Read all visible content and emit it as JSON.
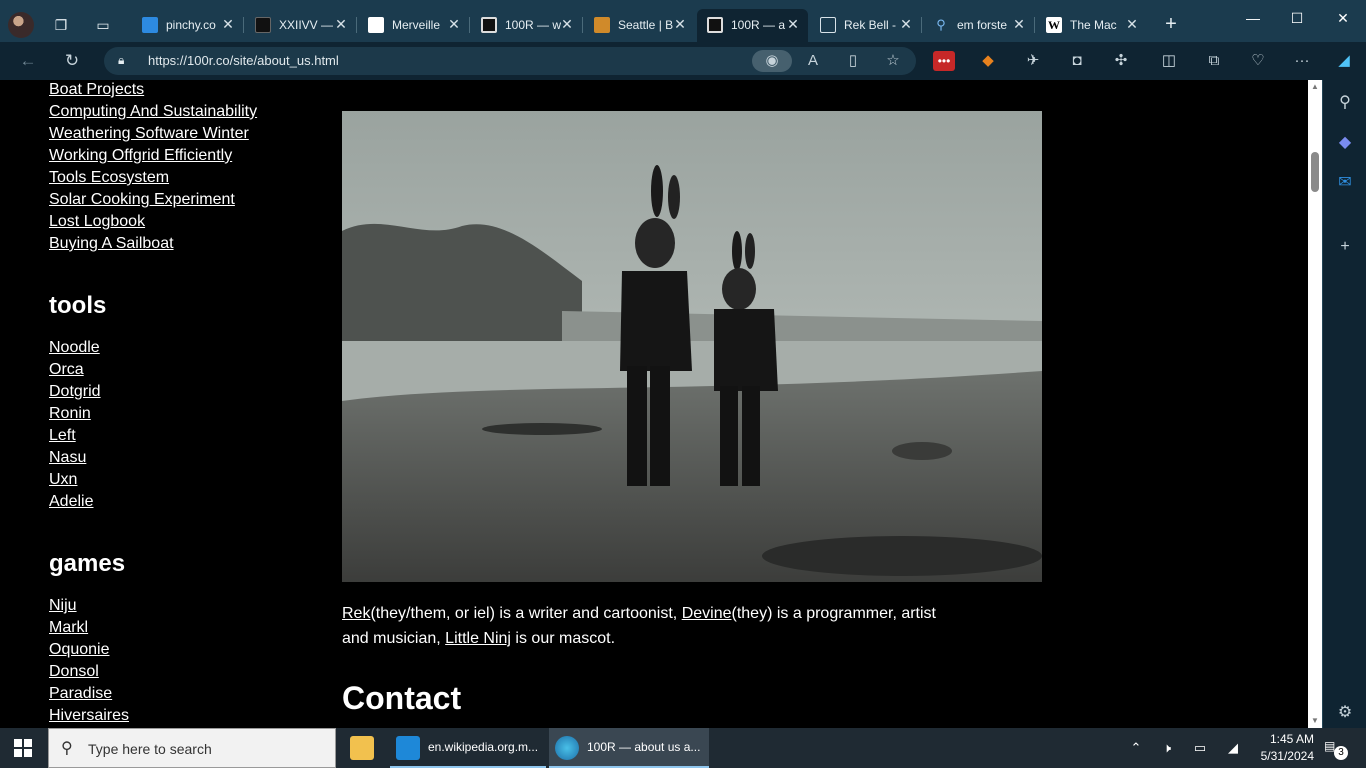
{
  "browser": {
    "tabs": [
      {
        "title": "pinchy.co",
        "favicon": "cc-icon",
        "color": "#2d8ae0"
      },
      {
        "title": "XXIIVV —",
        "favicon": "xxiivv-icon",
        "color": "#111111"
      },
      {
        "title": "Merveille",
        "favicon": "merveilles-icon",
        "color": "#ffffff"
      },
      {
        "title": "100R — w",
        "favicon": "100r-icon",
        "color": "#111111"
      },
      {
        "title": "Seattle | B",
        "favicon": "seattle-icon",
        "color": "#d08a2a"
      },
      {
        "title": "100R — a",
        "favicon": "100r-icon",
        "color": "#111111",
        "active": true
      },
      {
        "title": "Rek Bell -",
        "favicon": "document-icon",
        "color": "#0f2432"
      },
      {
        "title": "em forste",
        "favicon": "search-icon",
        "color": "#0f2432"
      },
      {
        "title": "The Mac",
        "favicon": "wikipedia-icon",
        "color": "#ffffff"
      }
    ],
    "url": "https://100r.co/site/about_us.html"
  },
  "sidebar_links": {
    "projects": [
      "Boat Projects",
      "Computing And Sustainability",
      "Weathering Software Winter",
      "Working Offgrid Efficiently",
      "Tools Ecosystem",
      "Solar Cooking Experiment",
      "Lost Logbook",
      "Buying A Sailboat"
    ],
    "tools_heading": "tools",
    "tools": [
      "Noodle",
      "Orca",
      "Dotgrid",
      "Ronin",
      "Left",
      "Nasu",
      "Uxn",
      "Adelie"
    ],
    "games_heading": "games",
    "games": [
      "Niju",
      "Markl",
      "Oquonie",
      "Donsol",
      "Paradise",
      "Hiversaires"
    ]
  },
  "main": {
    "para_rek": "Rek",
    "para_1": "(they/them, or iel) is a writer and cartoonist, ",
    "para_devine": "Devine",
    "para_2": "(they) is a programmer, artist and musician, ",
    "para_ninj": "Little Ninj",
    "para_3": " is our mascot.",
    "contact_heading": "Contact"
  },
  "taskbar": {
    "search_placeholder": "Type here to search",
    "apps": [
      {
        "label": "en.wikipedia.org.m...",
        "icon": "vscode-icon"
      },
      {
        "label": "100R — about us a...",
        "icon": "edge-icon"
      }
    ],
    "time": "1:45 AM",
    "date": "5/31/2024",
    "notification_count": "3"
  }
}
